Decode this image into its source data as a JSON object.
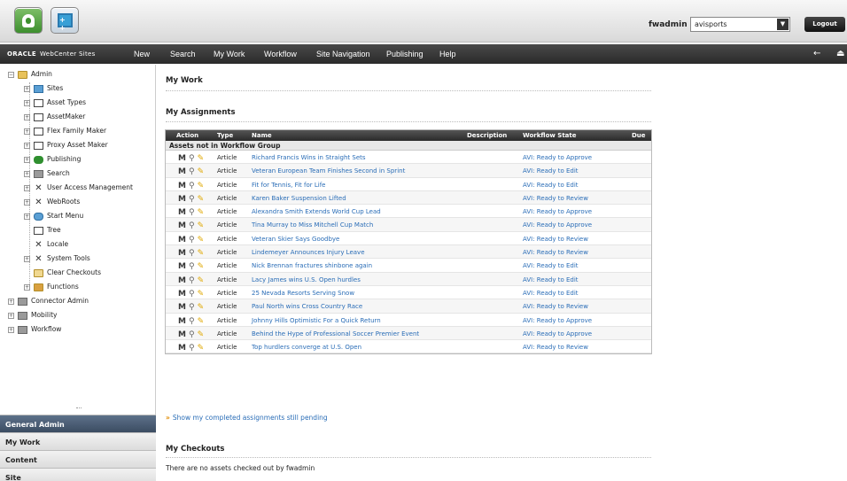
{
  "header": {
    "username": "fwadmin",
    "site_selected": "avisports",
    "logout_label": "Logout"
  },
  "navbar": {
    "brand_oracle": "ORACLE",
    "brand_product": "WebCenter Sites",
    "items": [
      "New",
      "Search",
      "My Work",
      "Workflow",
      "Site Navigation",
      "Publishing",
      "Help"
    ]
  },
  "sidebar": {
    "tree": [
      {
        "label": "Admin",
        "icon": "folder-open-icon",
        "toggle": "−"
      },
      {
        "label": "Sites",
        "icon": "sites-icon",
        "toggle": "+"
      },
      {
        "label": "Asset Types",
        "icon": "box-icon",
        "toggle": "+"
      },
      {
        "label": "AssetMaker",
        "icon": "box-icon",
        "toggle": "+"
      },
      {
        "label": "Flex Family Maker",
        "icon": "box-icon",
        "toggle": "+"
      },
      {
        "label": "Proxy Asset Maker",
        "icon": "box-icon",
        "toggle": "+"
      },
      {
        "label": "Publishing",
        "icon": "publishing-icon",
        "toggle": "+"
      },
      {
        "label": "Search",
        "icon": "search-icon",
        "toggle": "+"
      },
      {
        "label": "User Access Management",
        "icon": "tools-icon",
        "toggle": "+"
      },
      {
        "label": "WebRoots",
        "icon": "tools-icon",
        "toggle": "+"
      },
      {
        "label": "Start Menu",
        "icon": "start-menu-icon",
        "toggle": "+"
      },
      {
        "label": "Tree",
        "icon": "tree-icon",
        "toggle": ""
      },
      {
        "label": "Locale",
        "icon": "tools-icon",
        "toggle": ""
      },
      {
        "label": "System Tools",
        "icon": "tools-icon",
        "toggle": "+"
      },
      {
        "label": "Clear Checkouts",
        "icon": "checkout-icon",
        "toggle": ""
      },
      {
        "label": "Functions",
        "icon": "functions-icon",
        "toggle": "+"
      },
      {
        "label": "Connector Admin",
        "icon": "gray-folder-icon",
        "toggle": "+"
      },
      {
        "label": "Mobility",
        "icon": "gray-folder-icon",
        "toggle": "+"
      },
      {
        "label": "Workflow",
        "icon": "gray-folder-icon",
        "toggle": "+"
      }
    ],
    "accordion": [
      "General Admin",
      "My Work",
      "Content",
      "Site"
    ]
  },
  "main": {
    "title": "My Work",
    "assignments_title": "My Assignments",
    "columns": [
      "Action",
      "Type",
      "Name",
      "Description",
      "Workflow State",
      "Due"
    ],
    "group_label": "Assets not in Workflow Group",
    "rows": [
      {
        "type": "Article",
        "name": "Richard Francis Wins in Straight Sets",
        "state": "AVI: Ready to Approve"
      },
      {
        "type": "Article",
        "name": "Veteran European Team Finishes Second in Sprint",
        "state": "AVI: Ready to Edit"
      },
      {
        "type": "Article",
        "name": "Fit for Tennis, Fit for Life",
        "state": "AVI: Ready to Edit"
      },
      {
        "type": "Article",
        "name": "Karen Baker Suspension Lifted",
        "state": "AVI: Ready to Review"
      },
      {
        "type": "Article",
        "name": "Alexandra Smith Extends World Cup Lead",
        "state": "AVI: Ready to Approve"
      },
      {
        "type": "Article",
        "name": "Tina Murray to Miss Mitchell Cup Match",
        "state": "AVI: Ready to Approve"
      },
      {
        "type": "Article",
        "name": "Veteran Skier Says Goodbye",
        "state": "AVI: Ready to Review"
      },
      {
        "type": "Article",
        "name": "Lindemeyer Announces Injury Leave",
        "state": "AVI: Ready to Review"
      },
      {
        "type": "Article",
        "name": "Nick Brennan fractures shinbone again",
        "state": "AVI: Ready to Edit"
      },
      {
        "type": "Article",
        "name": "Lacy James wins U.S. Open hurdles",
        "state": "AVI: Ready to Edit"
      },
      {
        "type": "Article",
        "name": "25 Nevada Resorts Serving Snow",
        "state": "AVI: Ready to Edit"
      },
      {
        "type": "Article",
        "name": "Paul North wins Cross Country Race",
        "state": "AVI: Ready to Review"
      },
      {
        "type": "Article",
        "name": "Johnny Hills Optimistic For a Quick Return",
        "state": "AVI: Ready to Approve"
      },
      {
        "type": "Article",
        "name": "Behind the Hype of Professional Soccer Premier Event",
        "state": "AVI: Ready to Approve"
      },
      {
        "type": "Article",
        "name": "Top hurdlers converge at U.S. Open",
        "state": "AVI: Ready to Review"
      }
    ],
    "show_completed_label": "Show my completed assignments still pending",
    "checkouts_title": "My Checkouts",
    "checkouts_empty": "There are no assets checked out by fwadmin"
  }
}
